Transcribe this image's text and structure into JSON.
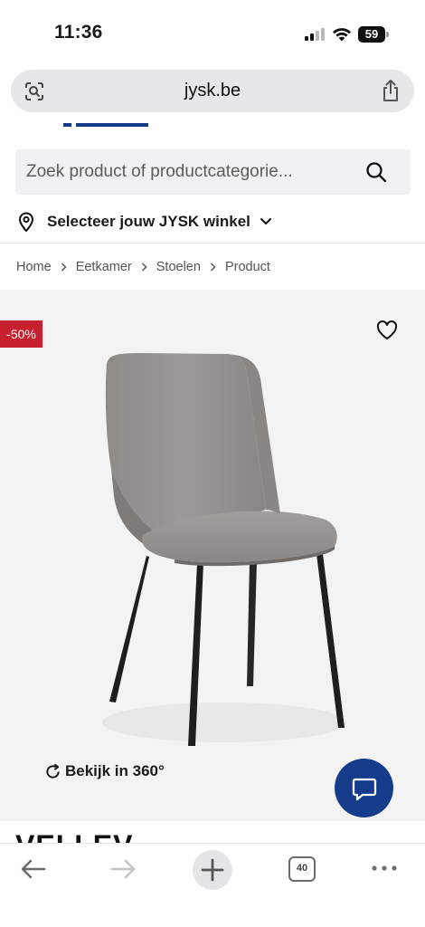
{
  "status_bar": {
    "time": "11:36",
    "battery": "59"
  },
  "browser": {
    "url": "jysk.be",
    "tab_count": "40"
  },
  "search": {
    "placeholder": "Zoek product of productcategorie..."
  },
  "store": {
    "label": "Selecteer jouw JYSK winkel"
  },
  "breadcrumb": [
    "Home",
    "Eetkamer",
    "Stoelen",
    "Product"
  ],
  "product": {
    "discount": "-50%",
    "view_360_label": "Bekijk in 360°",
    "title": "VELLEV"
  },
  "colors": {
    "brand_blue": "#143c8a",
    "discount_red": "#c8202f",
    "image_bg": "#f3f3f3"
  },
  "icons": [
    "lens-icon",
    "share-icon",
    "search-icon",
    "pin-icon",
    "chevron-down-icon",
    "chevron-right-icon",
    "heart-icon",
    "rotate-icon",
    "chat-icon",
    "back-icon",
    "forward-icon",
    "plus-icon",
    "tabs-icon",
    "more-icon"
  ]
}
